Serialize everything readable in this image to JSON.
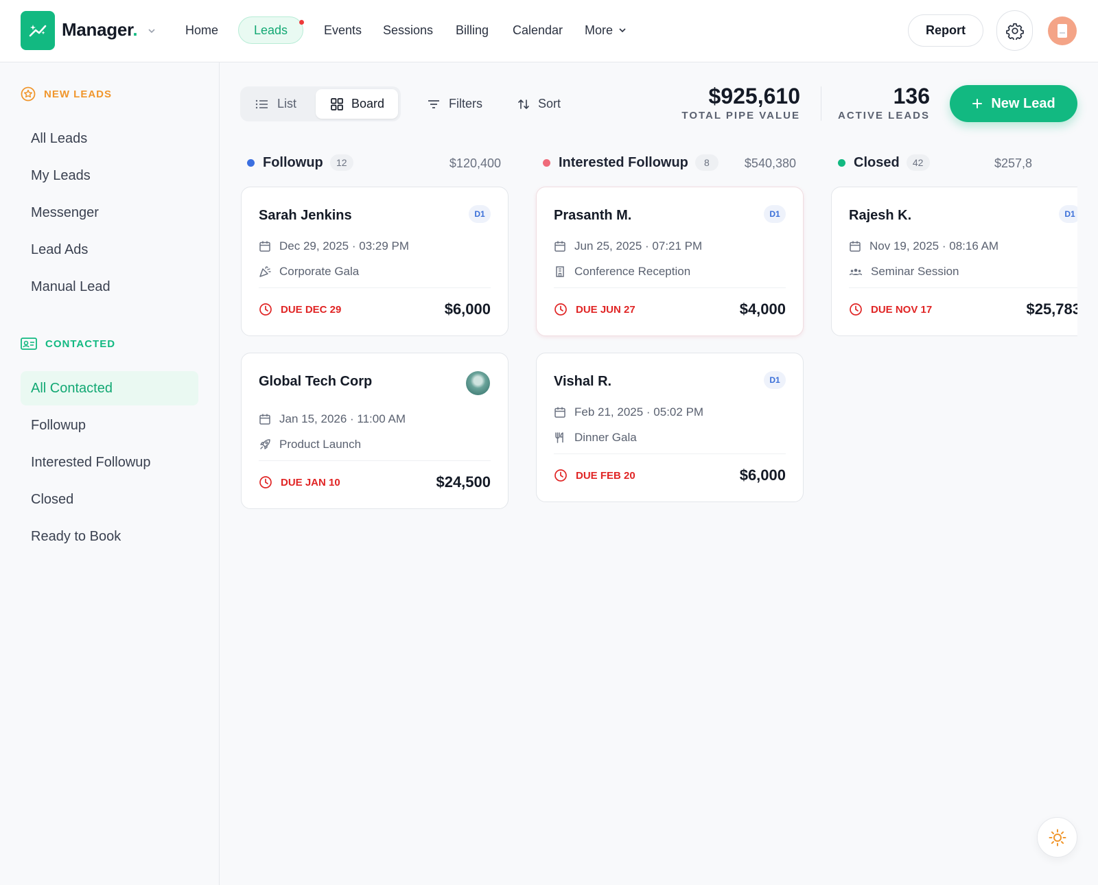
{
  "header": {
    "brand": "Manager",
    "brand_dot": ".",
    "nav": [
      "Home",
      "Leads",
      "Events",
      "Sessions",
      "Billing",
      "Calendar",
      "More"
    ],
    "active_nav": "Leads",
    "report_label": "Report"
  },
  "sidebar": {
    "new_leads_heading": "NEW LEADS",
    "new_leads_items": [
      "All Leads",
      "My Leads",
      "Messenger",
      "Lead Ads",
      "Manual Lead"
    ],
    "contacted_heading": "CONTACTED",
    "contacted_items": [
      "All Contacted",
      "Followup",
      "Interested Followup",
      "Closed",
      "Ready to Book"
    ],
    "active_item": "All Contacted"
  },
  "toolbar": {
    "view_list": "List",
    "view_board": "Board",
    "active_view": "Board",
    "filters": "Filters",
    "sort": "Sort",
    "total_pipe_value": "$925,610",
    "total_pipe_label": "TOTAL PIPE VALUE",
    "active_leads": "136",
    "active_leads_label": "ACTIVE LEADS",
    "new_lead": "New Lead"
  },
  "colors": {
    "accent": "#12b981",
    "followup": "#3b6fe0",
    "interested": "#ef6b7a",
    "closed": "#12b981",
    "due": "#e02424",
    "new_leads_heading": "#f0962c"
  },
  "columns": [
    {
      "title": "Followup",
      "count": "12",
      "value": "$120,400",
      "cards": [
        {
          "name": "Sarah Jenkins",
          "badge": "D1",
          "date": "Dec 29, 2025 · 03:29 PM",
          "event": "Corporate Gala",
          "event_icon": "party-popper-icon",
          "due": "DUE DEC 29",
          "amount": "$6,000"
        },
        {
          "name": "Global Tech Corp",
          "badge": "",
          "date": "Jan 15, 2026 · 11:00 AM",
          "event": "Product Launch",
          "event_icon": "rocket-icon",
          "due": "DUE JAN 10",
          "amount": "$24,500"
        }
      ]
    },
    {
      "title": "Interested Followup",
      "count": "8",
      "value": "$540,380",
      "cards": [
        {
          "name": "Prasanth M.",
          "badge": "D1",
          "date": "Jun 25, 2025 · 07:21 PM",
          "event": "Conference Reception",
          "event_icon": "building-icon",
          "due": "DUE JUN 27",
          "amount": "$4,000"
        },
        {
          "name": "Vishal R.",
          "badge": "D1",
          "date": "Feb 21, 2025 · 05:02 PM",
          "event": "Dinner Gala",
          "event_icon": "utensils-icon",
          "due": "DUE FEB 20",
          "amount": "$6,000"
        }
      ]
    },
    {
      "title": "Closed",
      "count": "42",
      "value": "$257,8",
      "cards": [
        {
          "name": "Rajesh K.",
          "badge": "D1",
          "date": "Nov 19, 2025 · 08:16 AM",
          "event": "Seminar Session",
          "event_icon": "users-icon",
          "due": "DUE NOV 17",
          "amount": "$25,783"
        }
      ]
    }
  ]
}
